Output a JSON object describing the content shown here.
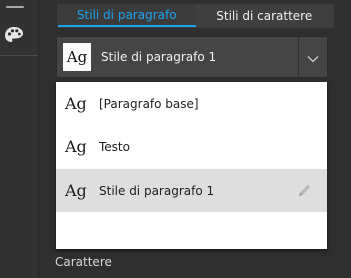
{
  "toolbar": {
    "icon": "palette-icon"
  },
  "tabs": [
    {
      "label": "Stili di paragrafo",
      "active": true
    },
    {
      "label": "Stili di carattere",
      "active": false
    }
  ],
  "selector": {
    "preview_glyph": "Ag",
    "value": "Stile di paragrafo 1"
  },
  "styles_list": [
    {
      "glyph": "Ag",
      "label": "[Paragrafo base]",
      "selected": false
    },
    {
      "glyph": "Ag",
      "label": "Testo",
      "selected": false
    },
    {
      "glyph": "Ag",
      "label": "Stile di paragrafo 1",
      "selected": true,
      "action_icon": "pencil-icon"
    }
  ],
  "section": {
    "label": "Carattere"
  },
  "colors": {
    "accent": "#1ca3f0",
    "panel_bg": "#2f2f2f",
    "list_bg": "#ffffff",
    "selected_row": "#dedede"
  }
}
